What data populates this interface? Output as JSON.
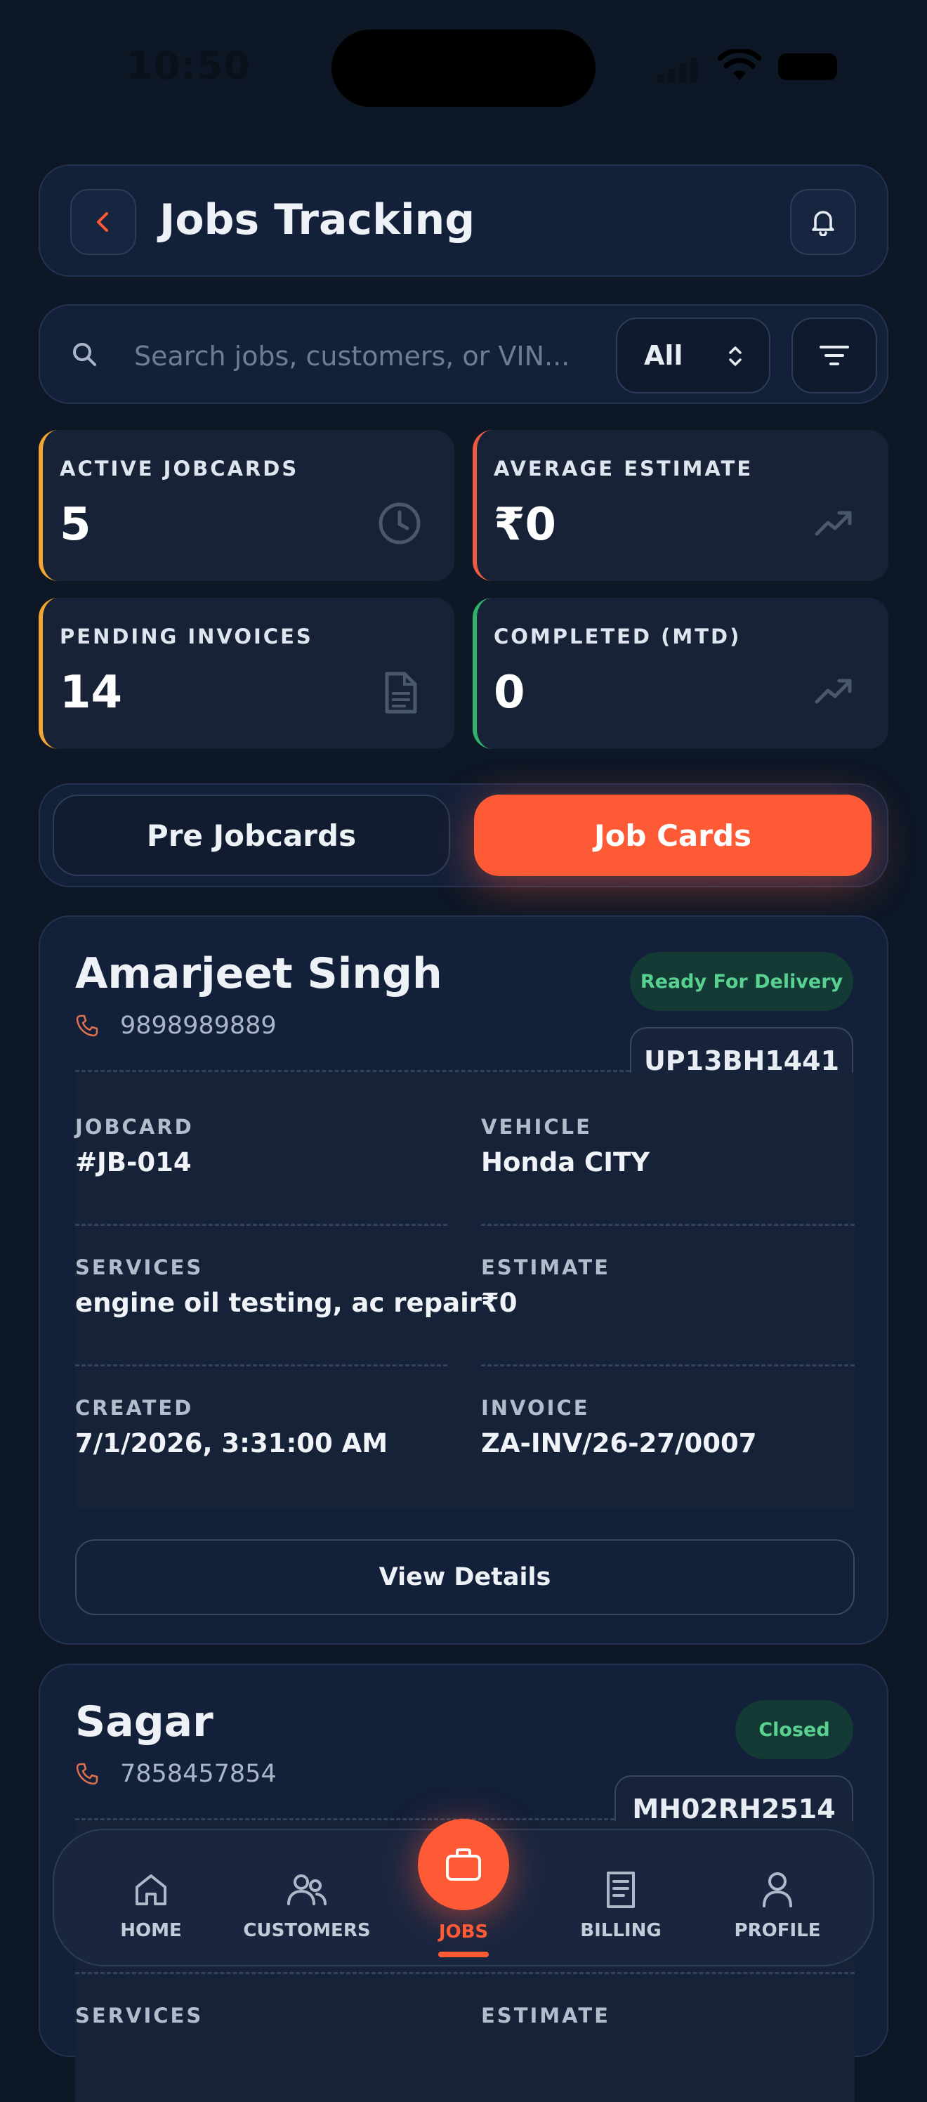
{
  "status_bar": {
    "time": "10:50"
  },
  "header": {
    "title": "Jobs Tracking"
  },
  "search": {
    "placeholder": "Search jobs, customers, or VIN...",
    "filter_value": "All"
  },
  "stats": [
    {
      "label": "ACTIVE JOBCARDS",
      "value": "5",
      "accent": "#f2a531",
      "icon": "clock-icon"
    },
    {
      "label": "AVERAGE ESTIMATE",
      "value": "₹0",
      "accent": "#ef5a3e",
      "icon": "trending-up-icon"
    },
    {
      "label": "PENDING INVOICES",
      "value": "14",
      "accent": "#f2a531",
      "icon": "document-icon"
    },
    {
      "label": "COMPLETED (MTD)",
      "value": "0",
      "accent": "#2fb36b",
      "icon": "trending-up-icon"
    }
  ],
  "tabs": {
    "pre": "Pre Jobcards",
    "job": "Job Cards",
    "active": "Job Cards"
  },
  "jobs": [
    {
      "customer": "Amarjeet Singh",
      "phone": "9898989889",
      "status": "Ready For Delivery",
      "plate": "UP13BH1441",
      "fields": {
        "jobcard_label": "JOBCARD",
        "jobcard": "#JB-014",
        "vehicle_label": "VEHICLE",
        "vehicle": "Honda CITY",
        "services_label": "SERVICES",
        "services": "engine oil testing, ac repair",
        "estimate_label": "ESTIMATE",
        "estimate": "₹0",
        "created_label": "CREATED",
        "created": "7/1/2026, 3:31:00 AM",
        "invoice_label": "INVOICE",
        "invoice": "ZA-INV/26-27/0007"
      },
      "action": "View Details"
    },
    {
      "customer": "Sagar",
      "phone": "7858457854",
      "status": "Closed",
      "plate": "MH02RH2514",
      "fields": {
        "services_label": "SERVICES",
        "estimate_label": "ESTIMATE"
      }
    }
  ],
  "nav": {
    "home": "HOME",
    "customers": "CUSTOMERS",
    "jobs": "JOBS",
    "billing": "BILLING",
    "profile": "PROFILE",
    "active": "JOBS"
  },
  "colors": {
    "accent": "#ff5a36",
    "background": "#0d1726",
    "success": "#59d191"
  }
}
